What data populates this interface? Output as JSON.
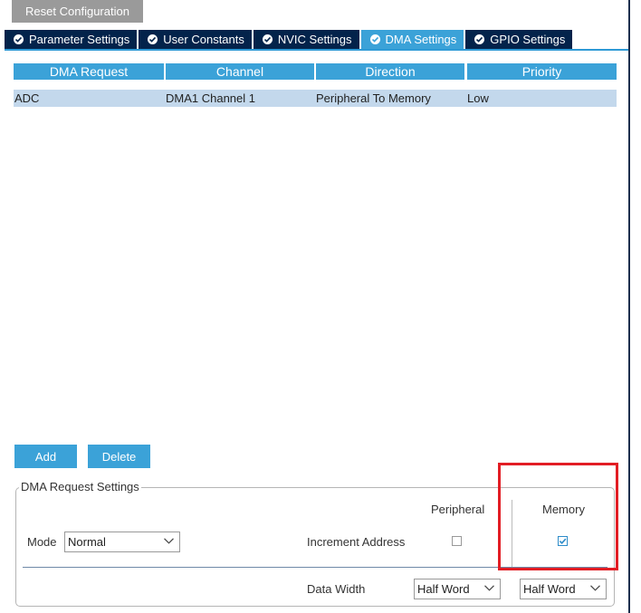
{
  "toolbar": {
    "reset_label": "Reset Configuration"
  },
  "tabs": [
    {
      "label": "Parameter Settings",
      "active": false
    },
    {
      "label": "User Constants",
      "active": false
    },
    {
      "label": "NVIC Settings",
      "active": false
    },
    {
      "label": "DMA Settings",
      "active": true
    },
    {
      "label": "GPIO Settings",
      "active": false
    }
  ],
  "table": {
    "headers": [
      "DMA Request",
      "Channel",
      "Direction",
      "Priority"
    ],
    "rows": [
      [
        "ADC",
        "DMA1 Channel 1",
        "Peripheral To Memory",
        "Low"
      ]
    ]
  },
  "actions": {
    "add_label": "Add",
    "delete_label": "Delete"
  },
  "settings": {
    "legend": "DMA Request Settings",
    "peripheral_header": "Peripheral",
    "memory_header": "Memory",
    "mode_label": "Mode",
    "mode_value": "Normal",
    "increment_label": "Increment Address",
    "peripheral_increment": false,
    "memory_increment": true,
    "data_width_label": "Data Width",
    "peripheral_data_width": "Half Word",
    "memory_data_width": "Half Word"
  },
  "colors": {
    "accent": "#3ba2d8",
    "tab_dark": "#03234b",
    "highlight": "#e21d24",
    "selected_row": "#c3d8ec"
  }
}
